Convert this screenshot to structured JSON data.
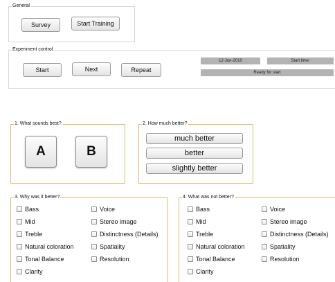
{
  "general": {
    "legend": "General",
    "survey_label": "Survey",
    "start_training_label": "Start Training"
  },
  "experiment": {
    "legend": "Experiment control",
    "start_label": "Start",
    "next_label": "Next",
    "repeat_label": "Repeat",
    "date": "12-Jun-2010",
    "start_time": "Start time:",
    "status": "Ready for start"
  },
  "q1": {
    "legend": "1. What sounds best?",
    "option_a": "A",
    "option_b": "B"
  },
  "q2": {
    "legend": "2. How much better?",
    "options": [
      "much better",
      "better",
      "slightly better"
    ]
  },
  "q3": {
    "legend": "3. Why was it better?",
    "col1": [
      "Bass",
      "Mid",
      "Treble",
      "Natural coloration",
      "Tonal Balance",
      "Clarity"
    ],
    "col2": [
      "Voice",
      "Stereo image",
      "Distinctness (Details)",
      "Spatiality",
      "Resolution"
    ]
  },
  "q4": {
    "legend": "4. What was not better?",
    "col1": [
      "Bass",
      "Mid",
      "Treble",
      "Natural coloration",
      "Tonal Balance",
      "Clarity"
    ],
    "col2": [
      "Voice",
      "Stereo image",
      "Distinctness (Details)",
      "Spatiality",
      "Resolution"
    ]
  },
  "colors": {
    "group_border": "#d6d6d6",
    "question_border": "#e8b26a",
    "field_bg": "#b3b3b3"
  }
}
